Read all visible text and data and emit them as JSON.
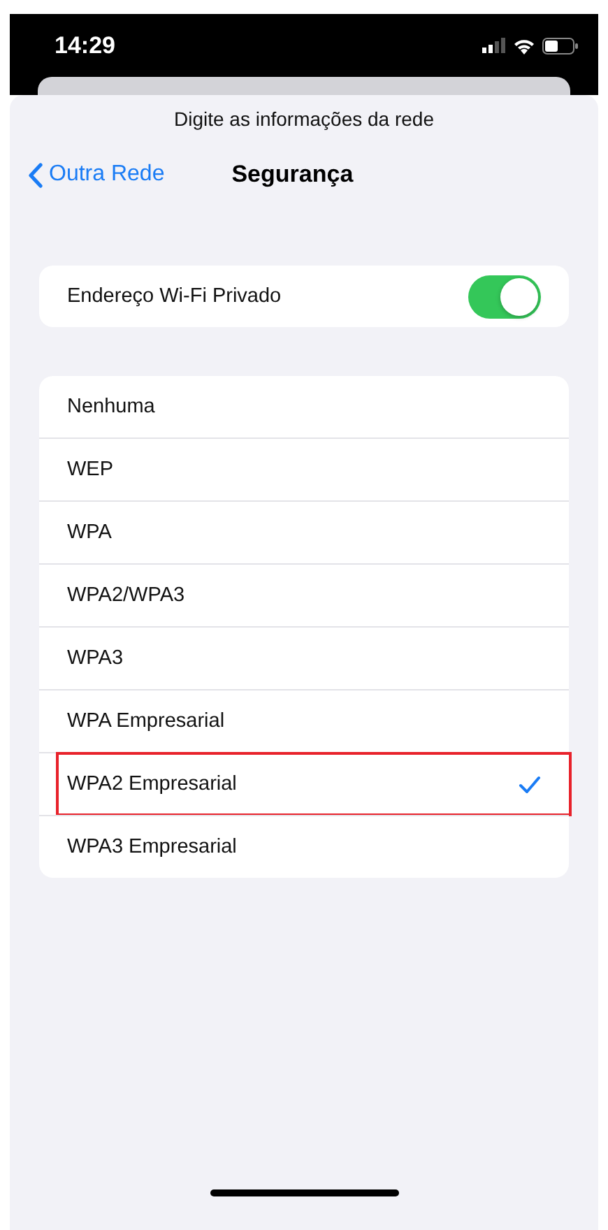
{
  "status_bar": {
    "time": "14:29"
  },
  "sheet": {
    "title": "Digite as informações da rede"
  },
  "nav": {
    "back_label": "Outra Rede",
    "title": "Segurança"
  },
  "private_address": {
    "label": "Endereço Wi-Fi Privado",
    "on": true
  },
  "security_options": [
    {
      "label": "Nenhuma",
      "selected": false,
      "highlighted": false
    },
    {
      "label": "WEP",
      "selected": false,
      "highlighted": false
    },
    {
      "label": "WPA",
      "selected": false,
      "highlighted": false
    },
    {
      "label": "WPA2/WPA3",
      "selected": false,
      "highlighted": false
    },
    {
      "label": "WPA3",
      "selected": false,
      "highlighted": false
    },
    {
      "label": "WPA Empresarial",
      "selected": false,
      "highlighted": false
    },
    {
      "label": "WPA2 Empresarial",
      "selected": true,
      "highlighted": true
    },
    {
      "label": "WPA3 Empresarial",
      "selected": false,
      "highlighted": false
    }
  ]
}
